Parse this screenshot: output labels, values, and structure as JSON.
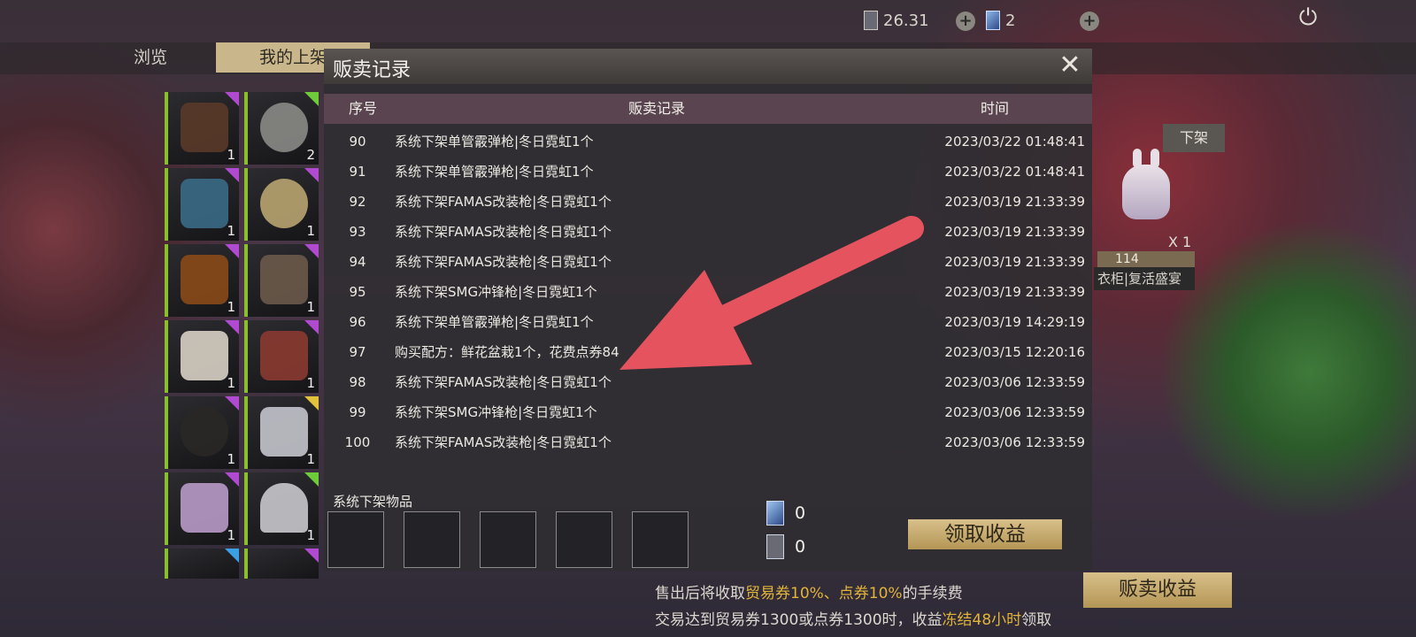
{
  "topbar": {
    "trade_tickets": "26.31",
    "voucher_cards": "2"
  },
  "tabs": {
    "browse": "浏览",
    "my_listings": "我的上架"
  },
  "inventory": {
    "counts": [
      "1",
      "2",
      "1",
      "1",
      "1",
      "1",
      "1",
      "1",
      "1",
      "1",
      "1",
      "1"
    ]
  },
  "side": {
    "unlist_button": "下架",
    "quantity": "X 1",
    "price": "114",
    "category": "衣柜|复活盛宴"
  },
  "modal": {
    "title": "贩卖记录",
    "columns": {
      "no": "序号",
      "record": "贩卖记录",
      "time": "时间"
    },
    "rows": [
      {
        "no": "90",
        "record": "系统下架单管霰弹枪|冬日霓虹1个",
        "time": "2023/03/22 01:48:41"
      },
      {
        "no": "91",
        "record": "系统下架单管霰弹枪|冬日霓虹1个",
        "time": "2023/03/22 01:48:41"
      },
      {
        "no": "92",
        "record": "系统下架FAMAS改装枪|冬日霓虹1个",
        "time": "2023/03/19 21:33:39"
      },
      {
        "no": "93",
        "record": "系统下架FAMAS改装枪|冬日霓虹1个",
        "time": "2023/03/19 21:33:39"
      },
      {
        "no": "94",
        "record": "系统下架FAMAS改装枪|冬日霓虹1个",
        "time": "2023/03/19 21:33:39"
      },
      {
        "no": "95",
        "record": "系统下架SMG冲锋枪|冬日霓虹1个",
        "time": "2023/03/19 21:33:39"
      },
      {
        "no": "96",
        "record": "系统下架单管霰弹枪|冬日霓虹1个",
        "time": "2023/03/19 14:29:19"
      },
      {
        "no": "97",
        "record": "购买配方：鲜花盆栽1个，花费点券84",
        "time": "2023/03/15 12:20:16"
      },
      {
        "no": "98",
        "record": "系统下架FAMAS改装枪|冬日霓虹1个",
        "time": "2023/03/06 12:33:59"
      },
      {
        "no": "99",
        "record": "系统下架SMG冲锋枪|冬日霓虹1个",
        "time": "2023/03/06 12:33:59"
      },
      {
        "no": "100",
        "record": "系统下架FAMAS改装枪|冬日霓虹1个",
        "time": "2023/03/06 12:33:59"
      }
    ],
    "system_unlisted_label": "系统下架物品",
    "voucher_amount": "0",
    "trade_ticket_amount": "0",
    "claim_button": "领取收益"
  },
  "footer": {
    "fee_prefix": "售出后将收取",
    "fee_highlight": "贸易券10%、点券10%",
    "fee_suffix": "的手续费",
    "freeze_prefix": "交易达到贸易券1300或点券1300时，收益",
    "freeze_highlight": "冻结48小时",
    "freeze_suffix": "领取",
    "sell_income_button": "贩卖收益"
  }
}
